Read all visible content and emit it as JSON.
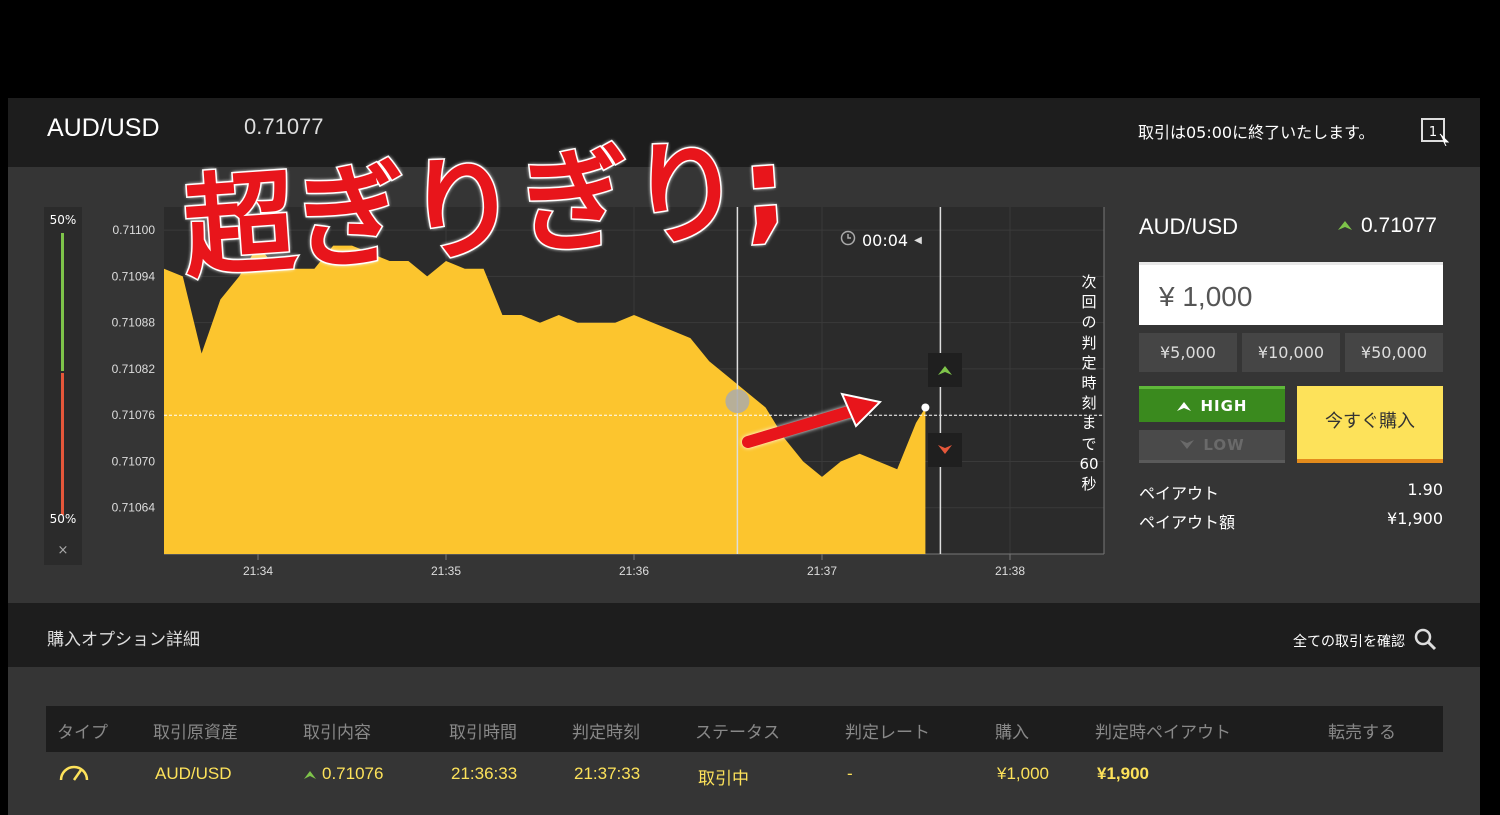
{
  "header": {
    "pair": "AUD/USD",
    "rate": "0.71077",
    "close_notice": "取引は05:00に終了いたします。"
  },
  "overlay": {
    "text": "超ぎりぎり;"
  },
  "chart": {
    "countdown": "00:04",
    "next_judge_text": [
      "次",
      "回",
      "の",
      "判",
      "定",
      "時",
      "刻",
      "ま",
      "で",
      "60",
      "秒"
    ],
    "side_top_pct": "50%",
    "side_bottom_pct": "50%",
    "close_symbol": "×",
    "colors": {
      "area": "#fcc52e",
      "bg": "#2b2b2b",
      "up": "#7ec44a",
      "down": "#e5573a"
    }
  },
  "chart_data": {
    "type": "area",
    "y_ticks": [
      "0.71100",
      "0.71094",
      "0.71088",
      "0.71082",
      "0.71076",
      "0.71070",
      "0.71064"
    ],
    "x_ticks": [
      "21:34",
      "21:35",
      "21:36",
      "21:37",
      "21:38"
    ],
    "ylim": [
      0.71058,
      0.71103
    ],
    "strike_rate": 0.71076,
    "current_rate": 0.71077,
    "x": [
      "21:33:30",
      "21:33:36",
      "21:33:42",
      "21:33:48",
      "21:33:54",
      "21:34:00",
      "21:34:06",
      "21:34:12",
      "21:34:18",
      "21:34:24",
      "21:34:30",
      "21:34:36",
      "21:34:42",
      "21:34:48",
      "21:34:54",
      "21:35:00",
      "21:35:06",
      "21:35:12",
      "21:35:18",
      "21:35:24",
      "21:35:30",
      "21:35:36",
      "21:35:42",
      "21:35:48",
      "21:35:54",
      "21:36:00",
      "21:36:06",
      "21:36:12",
      "21:36:18",
      "21:36:24",
      "21:36:30",
      "21:36:36",
      "21:36:42",
      "21:36:48",
      "21:36:54",
      "21:37:00",
      "21:37:06",
      "21:37:12",
      "21:37:18",
      "21:37:24",
      "21:37:30",
      "21:37:33"
    ],
    "values": [
      0.71095,
      0.71094,
      0.71084,
      0.71091,
      0.71094,
      0.71098,
      0.71095,
      0.71095,
      0.71095,
      0.71098,
      0.71098,
      0.71097,
      0.71096,
      0.71096,
      0.71094,
      0.71096,
      0.71095,
      0.71095,
      0.71089,
      0.71089,
      0.71088,
      0.71089,
      0.71088,
      0.71088,
      0.71088,
      0.71089,
      0.71088,
      0.71087,
      0.71086,
      0.71083,
      0.71081,
      0.71079,
      0.71077,
      0.71073,
      0.7107,
      0.71068,
      0.7107,
      0.71071,
      0.7107,
      0.71069,
      0.71075,
      0.71077
    ]
  },
  "panel": {
    "pair": "AUD/USD",
    "rate": "0.71077",
    "amount": "¥ 1,000",
    "presets": [
      "¥5,000",
      "¥10,000",
      "¥50,000"
    ],
    "high_label": "HIGH",
    "low_label": "LOW",
    "buy_label": "今すぐ購入",
    "payout_label": "ペイアウト",
    "payout_value": "1.90",
    "payout_amount_label": "ペイアウト額",
    "payout_amount_value": "¥1,900"
  },
  "details": {
    "title": "購入オプション詳細",
    "all_trades": "全ての取引を確認",
    "columns": [
      "タイプ",
      "取引原資産",
      "取引内容",
      "取引時間",
      "判定時刻",
      "ステータス",
      "判定レート",
      "購入",
      "判定時ペイアウト",
      "転売する"
    ],
    "row": {
      "asset": "AUD/USD",
      "rate": "0.71076",
      "trade_time": "21:36:33",
      "judge_time": "21:37:33",
      "status": "取引中",
      "judge_rate": "-",
      "purchase": "¥1,000",
      "payout": "¥1,900"
    }
  }
}
